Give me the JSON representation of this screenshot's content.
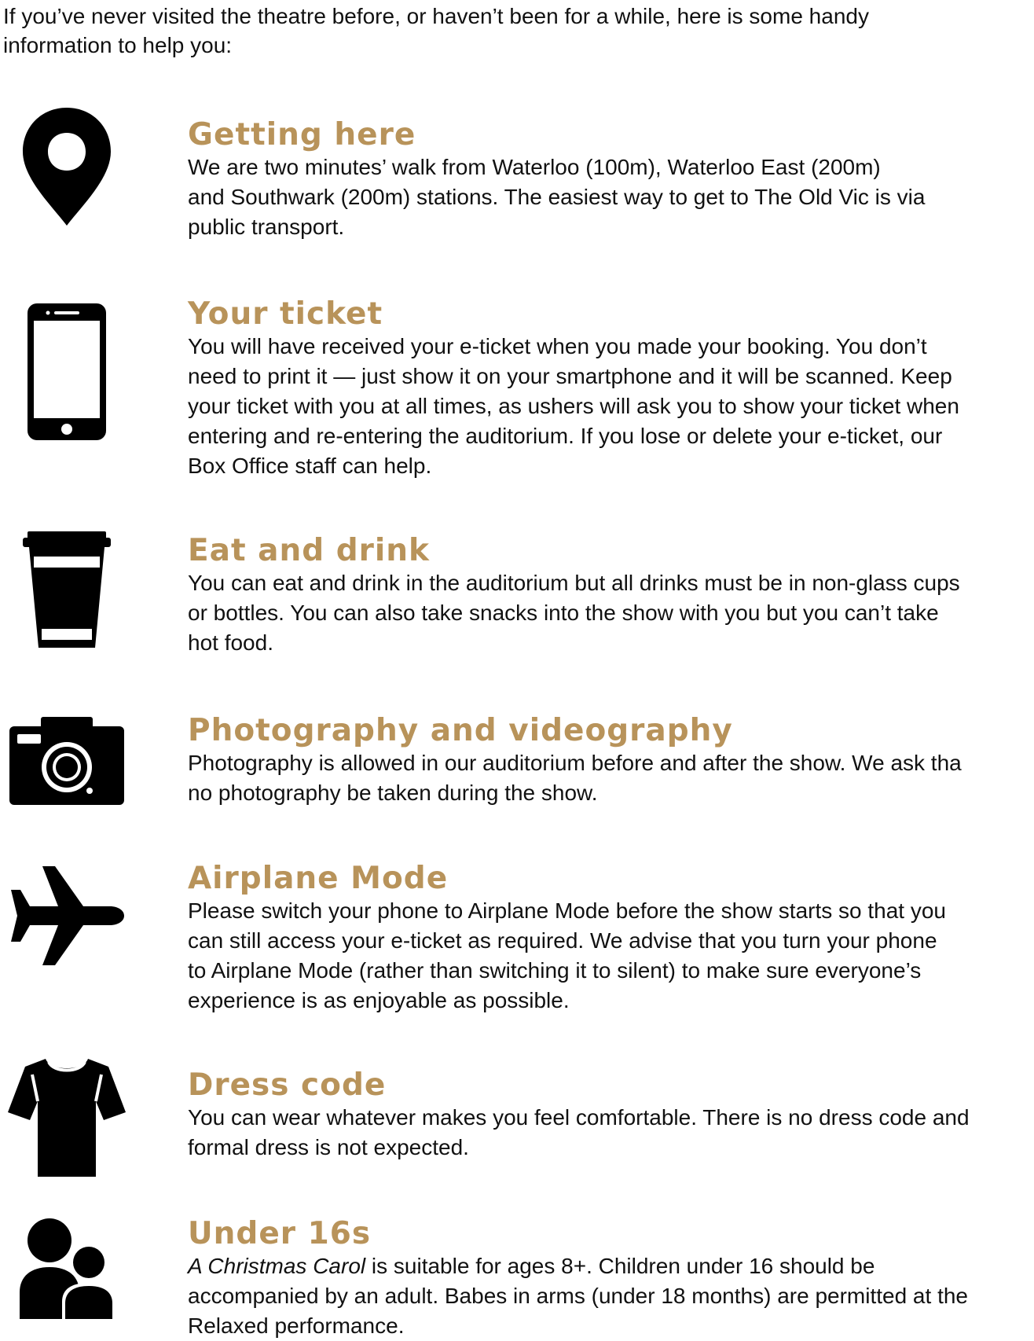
{
  "intro": {
    "line1": "If you’ve never visited the theatre before, or haven’t been for a while, here is some handy",
    "line2": "information to help you:"
  },
  "colors": {
    "heading": "#b8935a",
    "text": "#111111",
    "icon": "#000000"
  },
  "sections": [
    {
      "icon": "location-pin-icon",
      "heading": "Getting here",
      "lines": [
        "We are two minutes’ walk from Waterloo (100m), Waterloo East (200m)",
        "and Southwark (200m) stations. The easiest way to get to The Old Vic is via",
        "public transport."
      ]
    },
    {
      "icon": "smartphone-icon",
      "heading": "Your ticket",
      "lines": [
        "You will have received your e-ticket when you made your booking. You don’t",
        "need to print it — just show it on your smartphone and it will be scanned. Keep",
        "your ticket with you at all times, as ushers will ask you to show your ticket when",
        "entering and re-entering the auditorium. If you lose or delete your e-ticket, our",
        "Box Office staff can help."
      ]
    },
    {
      "icon": "takeaway-cup-icon",
      "heading": "Eat and drink",
      "lines": [
        "You can eat and drink in the auditorium but all drinks must be in non-glass cups",
        "or bottles. You can also take snacks into the show with you but you can’t take",
        "hot food."
      ]
    },
    {
      "icon": "camera-icon",
      "heading": "Photography and videography",
      "lines": [
        "Photography is allowed in our auditorium before and after the show. We ask tha",
        "no photography be taken during the show."
      ]
    },
    {
      "icon": "airplane-icon",
      "heading": "Airplane Mode",
      "lines": [
        "Please switch your phone to Airplane Mode before the show starts so that you",
        "can still access your e-ticket as required. We advise that you turn your phone",
        "to Airplane Mode (rather than switching it to silent) to make sure everyone’s",
        "experience is as enjoyable as possible."
      ]
    },
    {
      "icon": "t-shirt-icon",
      "heading": "Dress code",
      "lines": [
        "You can wear whatever makes you feel comfortable. There is no dress code and",
        "formal dress is not expected."
      ]
    },
    {
      "icon": "people-icon",
      "heading": "Under 16s",
      "title_italic": "A Christmas Carol",
      "line1_rest": " is suitable for ages 8+. Children under 16 should be",
      "lines": [
        "accompanied by an adult. Babes in arms (under 18 months) are permitted at the",
        "Relaxed performance."
      ]
    }
  ]
}
